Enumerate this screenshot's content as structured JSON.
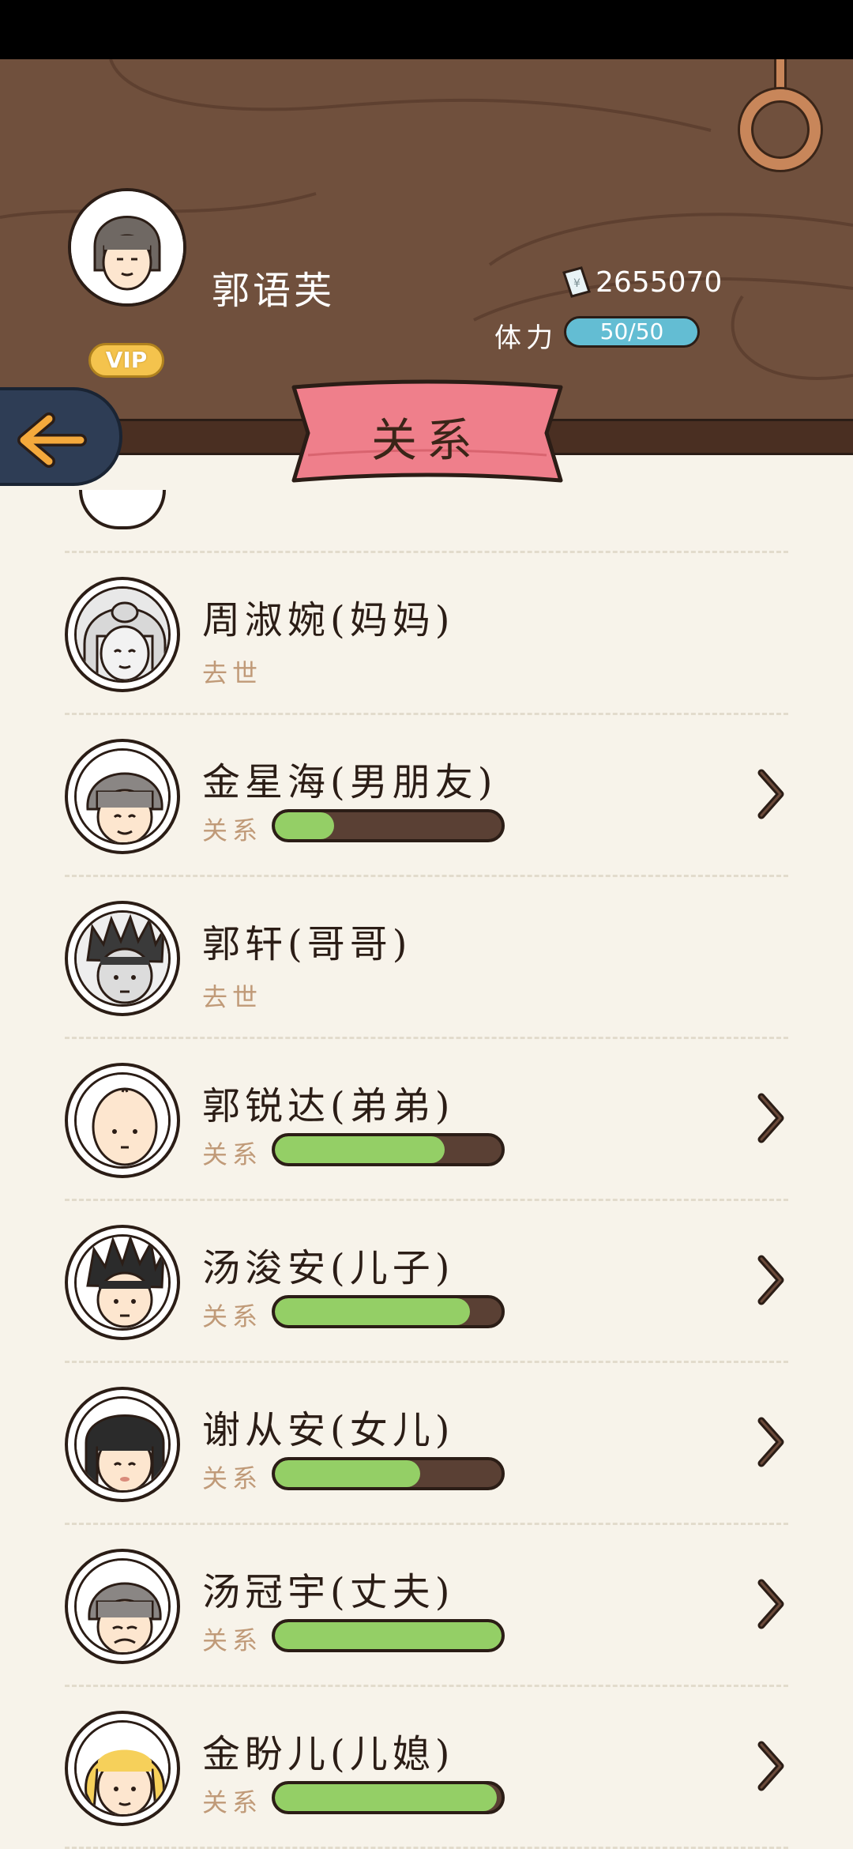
{
  "header": {
    "player_name": "郭语芙",
    "vip_label": "VIP",
    "money": "2655070",
    "stamina_label": "体力",
    "stamina_value": "50/50"
  },
  "title": "关系",
  "icons": {
    "back": "back-arrow-icon",
    "money": "money-note-icon",
    "chevron": "chevron-right-icon",
    "ring": "ring-icon"
  },
  "colors": {
    "bar_fill": "#94cf66",
    "bar_track": "#5a4034",
    "stamina": "#63bdd3",
    "ribbon": "#ef7f8b",
    "wood": "#70503d"
  },
  "relations": [
    {
      "name": "周淑婉(妈妈)",
      "status": "去世",
      "deceased": true,
      "level": null
    },
    {
      "name": "金星海(男朋友)",
      "status": "关系",
      "deceased": false,
      "level": 0.26
    },
    {
      "name": "郭轩(哥哥)",
      "status": "去世",
      "deceased": true,
      "level": null
    },
    {
      "name": "郭锐达(弟弟)",
      "status": "关系",
      "deceased": false,
      "level": 0.75
    },
    {
      "name": "汤浚安(儿子)",
      "status": "关系",
      "deceased": false,
      "level": 0.86
    },
    {
      "name": "谢从安(女儿)",
      "status": "关系",
      "deceased": false,
      "level": 0.64
    },
    {
      "name": "汤冠宇(丈夫)",
      "status": "关系",
      "deceased": false,
      "level": 1.0
    },
    {
      "name": "金盼儿(儿媳)",
      "status": "关系",
      "deceased": false,
      "level": 0.98
    }
  ]
}
